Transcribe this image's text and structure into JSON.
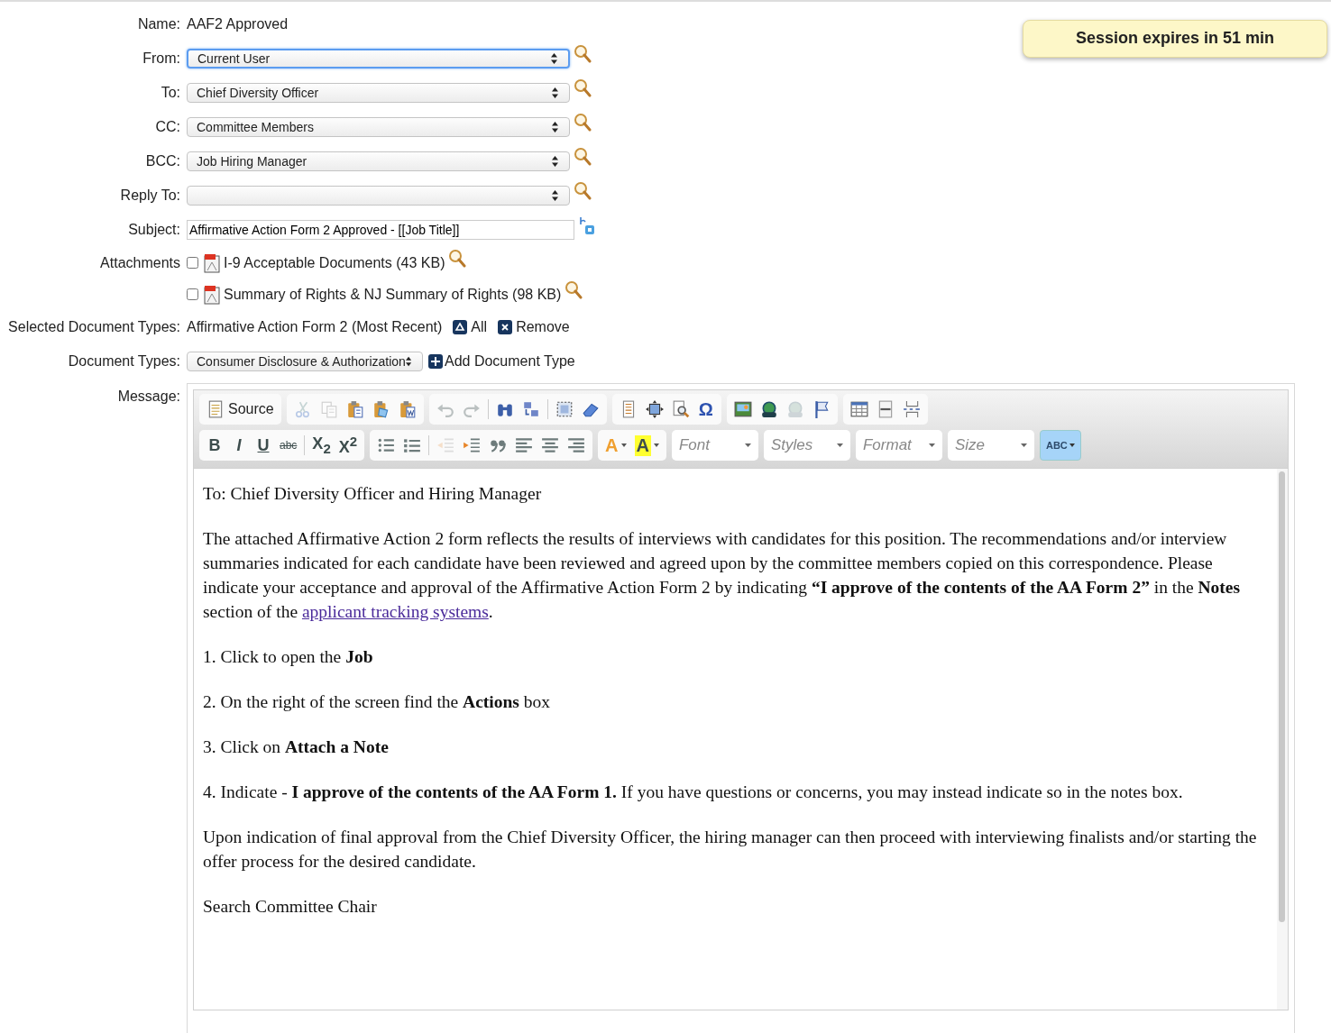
{
  "session_notice": "Session expires in 51 min",
  "name": {
    "label": "Name:",
    "value": "AAF2 Approved"
  },
  "recipients": [
    {
      "label": "From:",
      "value": "Current User",
      "focused": true
    },
    {
      "label": "To:",
      "value": "Chief Diversity Officer",
      "focused": false
    },
    {
      "label": "CC:",
      "value": "Committee Members",
      "focused": false
    },
    {
      "label": "BCC:",
      "value": "Job Hiring Manager",
      "focused": false
    },
    {
      "label": "Reply To:",
      "focused": false
    }
  ],
  "subject": {
    "label": "Subject:",
    "value": "Affirmative Action Form 2 Approved - [[Job Title]]"
  },
  "attachments": {
    "label": "Attachments",
    "items": [
      {
        "name": "I-9 Acceptable Documents (43 KB)",
        "checked": false
      },
      {
        "name": "Summary of Rights & NJ Summary of Rights (98 KB)",
        "checked": false
      }
    ]
  },
  "selected_document_types": {
    "label": "Selected Document Types:",
    "value": "Affirmative Action Form 2 (Most Recent)",
    "all": "All",
    "remove": "Remove"
  },
  "document_types": {
    "label": "Document Types:",
    "value": "Consumer Disclosure & Authorization",
    "add": "Add Document Type"
  },
  "message": {
    "label": "Message:",
    "toolbar_rows": [
      [
        {
          "segments": [
            [
              {
                "kind": "source",
                "label": "Source",
                "disabled": false
              }
            ]
          ]
        },
        {
          "segments": [
            [
              {
                "kind": "cut",
                "disabled": true
              },
              {
                "kind": "copy",
                "disabled": true
              },
              {
                "kind": "paste",
                "disabled": false
              },
              {
                "kind": "paste-text",
                "disabled": false
              },
              {
                "kind": "paste-word",
                "disabled": false
              }
            ]
          ]
        },
        {
          "segments": [
            [
              {
                "kind": "undo",
                "disabled": true
              },
              {
                "kind": "redo",
                "disabled": true
              }
            ],
            [
              {
                "kind": "find",
                "disabled": false
              },
              {
                "kind": "replace",
                "disabled": false
              }
            ],
            [
              {
                "kind": "select-all",
                "disabled": false
              },
              {
                "kind": "remove-format",
                "disabled": false
              }
            ]
          ]
        },
        {
          "segments": [
            [
              {
                "kind": "templates",
                "disabled": false
              },
              {
                "kind": "maximize",
                "disabled": false
              },
              {
                "kind": "preview",
                "disabled": false
              },
              {
                "kind": "special-char",
                "label": "Ω",
                "disabled": false
              }
            ]
          ]
        },
        {
          "segments": [
            [
              {
                "kind": "image",
                "disabled": false
              },
              {
                "kind": "flash",
                "disabled": false
              },
              {
                "kind": "iframe",
                "disabled": true
              },
              {
                "kind": "anchor",
                "disabled": false
              }
            ]
          ]
        },
        {
          "segments": [
            [
              {
                "kind": "table",
                "disabled": false
              },
              {
                "kind": "hr",
                "disabled": false
              },
              {
                "kind": "page-break",
                "disabled": false
              }
            ]
          ]
        }
      ],
      [
        {
          "segments": [
            [
              {
                "kind": "bold",
                "label": "B",
                "disabled": false
              },
              {
                "kind": "italic",
                "label": "I",
                "disabled": false
              },
              {
                "kind": "underline",
                "label": "U",
                "disabled": false
              },
              {
                "kind": "strike",
                "label": "abc",
                "disabled": false
              }
            ],
            [
              {
                "kind": "subscript",
                "label": "X$_{2}$",
                "disabled": false
              },
              {
                "kind": "superscript",
                "label": "X$^{2}$",
                "disabled": false
              }
            ]
          ]
        },
        {
          "segments": [
            [
              {
                "kind": "numbered-list",
                "disabled": false
              },
              {
                "kind": "bulleted-list",
                "disabled": false
              }
            ],
            [
              {
                "kind": "outdent",
                "disabled": true
              },
              {
                "kind": "indent",
                "disabled": false
              },
              {
                "kind": "blockquote",
                "disabled": false
              },
              {
                "kind": "align-left",
                "disabled": false
              },
              {
                "kind": "align-center",
                "disabled": false
              },
              {
                "kind": "align-right",
                "disabled": false
              }
            ]
          ]
        },
        {
          "segments": [
            [
              {
                "kind": "text-color",
                "label": "A",
                "disabled": false
              },
              {
                "kind": "background-color",
                "label": "A",
                "disabled": false
              }
            ]
          ]
        }
      ]
    ],
    "combos": [
      "Font",
      "Styles",
      "Format",
      "Size"
    ],
    "spellcheck": {
      "label": "ABC",
      "active": true
    },
    "paragraphs": [
      {
        "text": "To: Chief Diversity Officer and Hiring Manager"
      },
      {
        "text": "The attached Affirmative Action 2 form reflects the results of interviews with candidates for this position.  The recommendations and/or interview summaries indicated for each candidate have been reviewed and agreed upon by the committee members copied on this correspondence.   Please indicate your acceptance and approval of the Affirmative Action Form 2  by indicating **“I approve of the contents of the AA Form 2”** in the **Notes** section of the",
        "link": "applicant tracking systems",
        "after": "."
      },
      {
        "text": "1.  Click to open the **Job**"
      },
      {
        "text": "2.  On the right of the screen find the **Actions** box"
      },
      {
        "text": "3. Click on **Attach a Note**"
      },
      {
        "text": "4. Indicate - **I approve of the contents of the AA Form 1.**  If you have questions or concerns, you may instead indicate so in the notes box."
      },
      {
        "text": "Upon indication of final approval from the Chief Diversity Officer, the hiring manager can then proceed with interviewing finalists and/or starting the offer process for the desired candidate."
      },
      {
        "text": "Search Committee Chair"
      }
    ]
  }
}
